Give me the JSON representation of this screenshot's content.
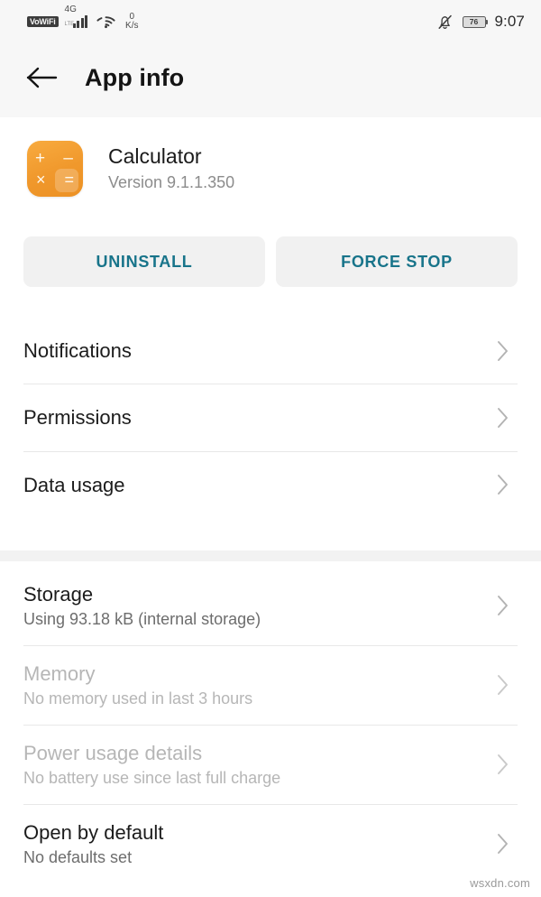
{
  "status_bar": {
    "vowifi_label": "VoWiFi",
    "network_type": "4G",
    "network_sub": "LTE",
    "wifi_icon": "wifi-icon",
    "net_speed_value": "0",
    "net_speed_unit": "K/s",
    "mute_icon": "bell-off-icon",
    "battery_level": "76",
    "time": "9:07"
  },
  "app_bar": {
    "back_icon": "back-arrow-icon",
    "title": "App info"
  },
  "app": {
    "icon_name": "calculator-icon",
    "icon_color": "#f0982c",
    "glyph_plus": "+",
    "glyph_minus": "–",
    "glyph_times": "×",
    "glyph_equals": "=",
    "name": "Calculator",
    "version": "Version 9.1.1.350"
  },
  "actions": {
    "uninstall_label": "UNINSTALL",
    "force_stop_label": "FORCE STOP",
    "accent_color": "#18748a"
  },
  "sections": [
    {
      "rows": [
        {
          "title": "Notifications",
          "subtitle": "",
          "disabled": false,
          "name": "row-notifications"
        },
        {
          "title": "Permissions",
          "subtitle": "",
          "disabled": false,
          "name": "row-permissions"
        },
        {
          "title": "Data usage",
          "subtitle": "",
          "disabled": false,
          "name": "row-data-usage"
        }
      ]
    },
    {
      "rows": [
        {
          "title": "Storage",
          "subtitle": "Using 93.18 kB (internal storage)",
          "disabled": false,
          "name": "row-storage"
        },
        {
          "title": "Memory",
          "subtitle": "No memory used in last 3 hours",
          "disabled": true,
          "name": "row-memory"
        },
        {
          "title": "Power usage details",
          "subtitle": "No battery use since last full charge",
          "disabled": true,
          "name": "row-power-usage"
        },
        {
          "title": "Open by default",
          "subtitle": "No defaults set",
          "disabled": false,
          "name": "row-open-by-default"
        }
      ]
    }
  ],
  "watermark": "wsxdn.com"
}
